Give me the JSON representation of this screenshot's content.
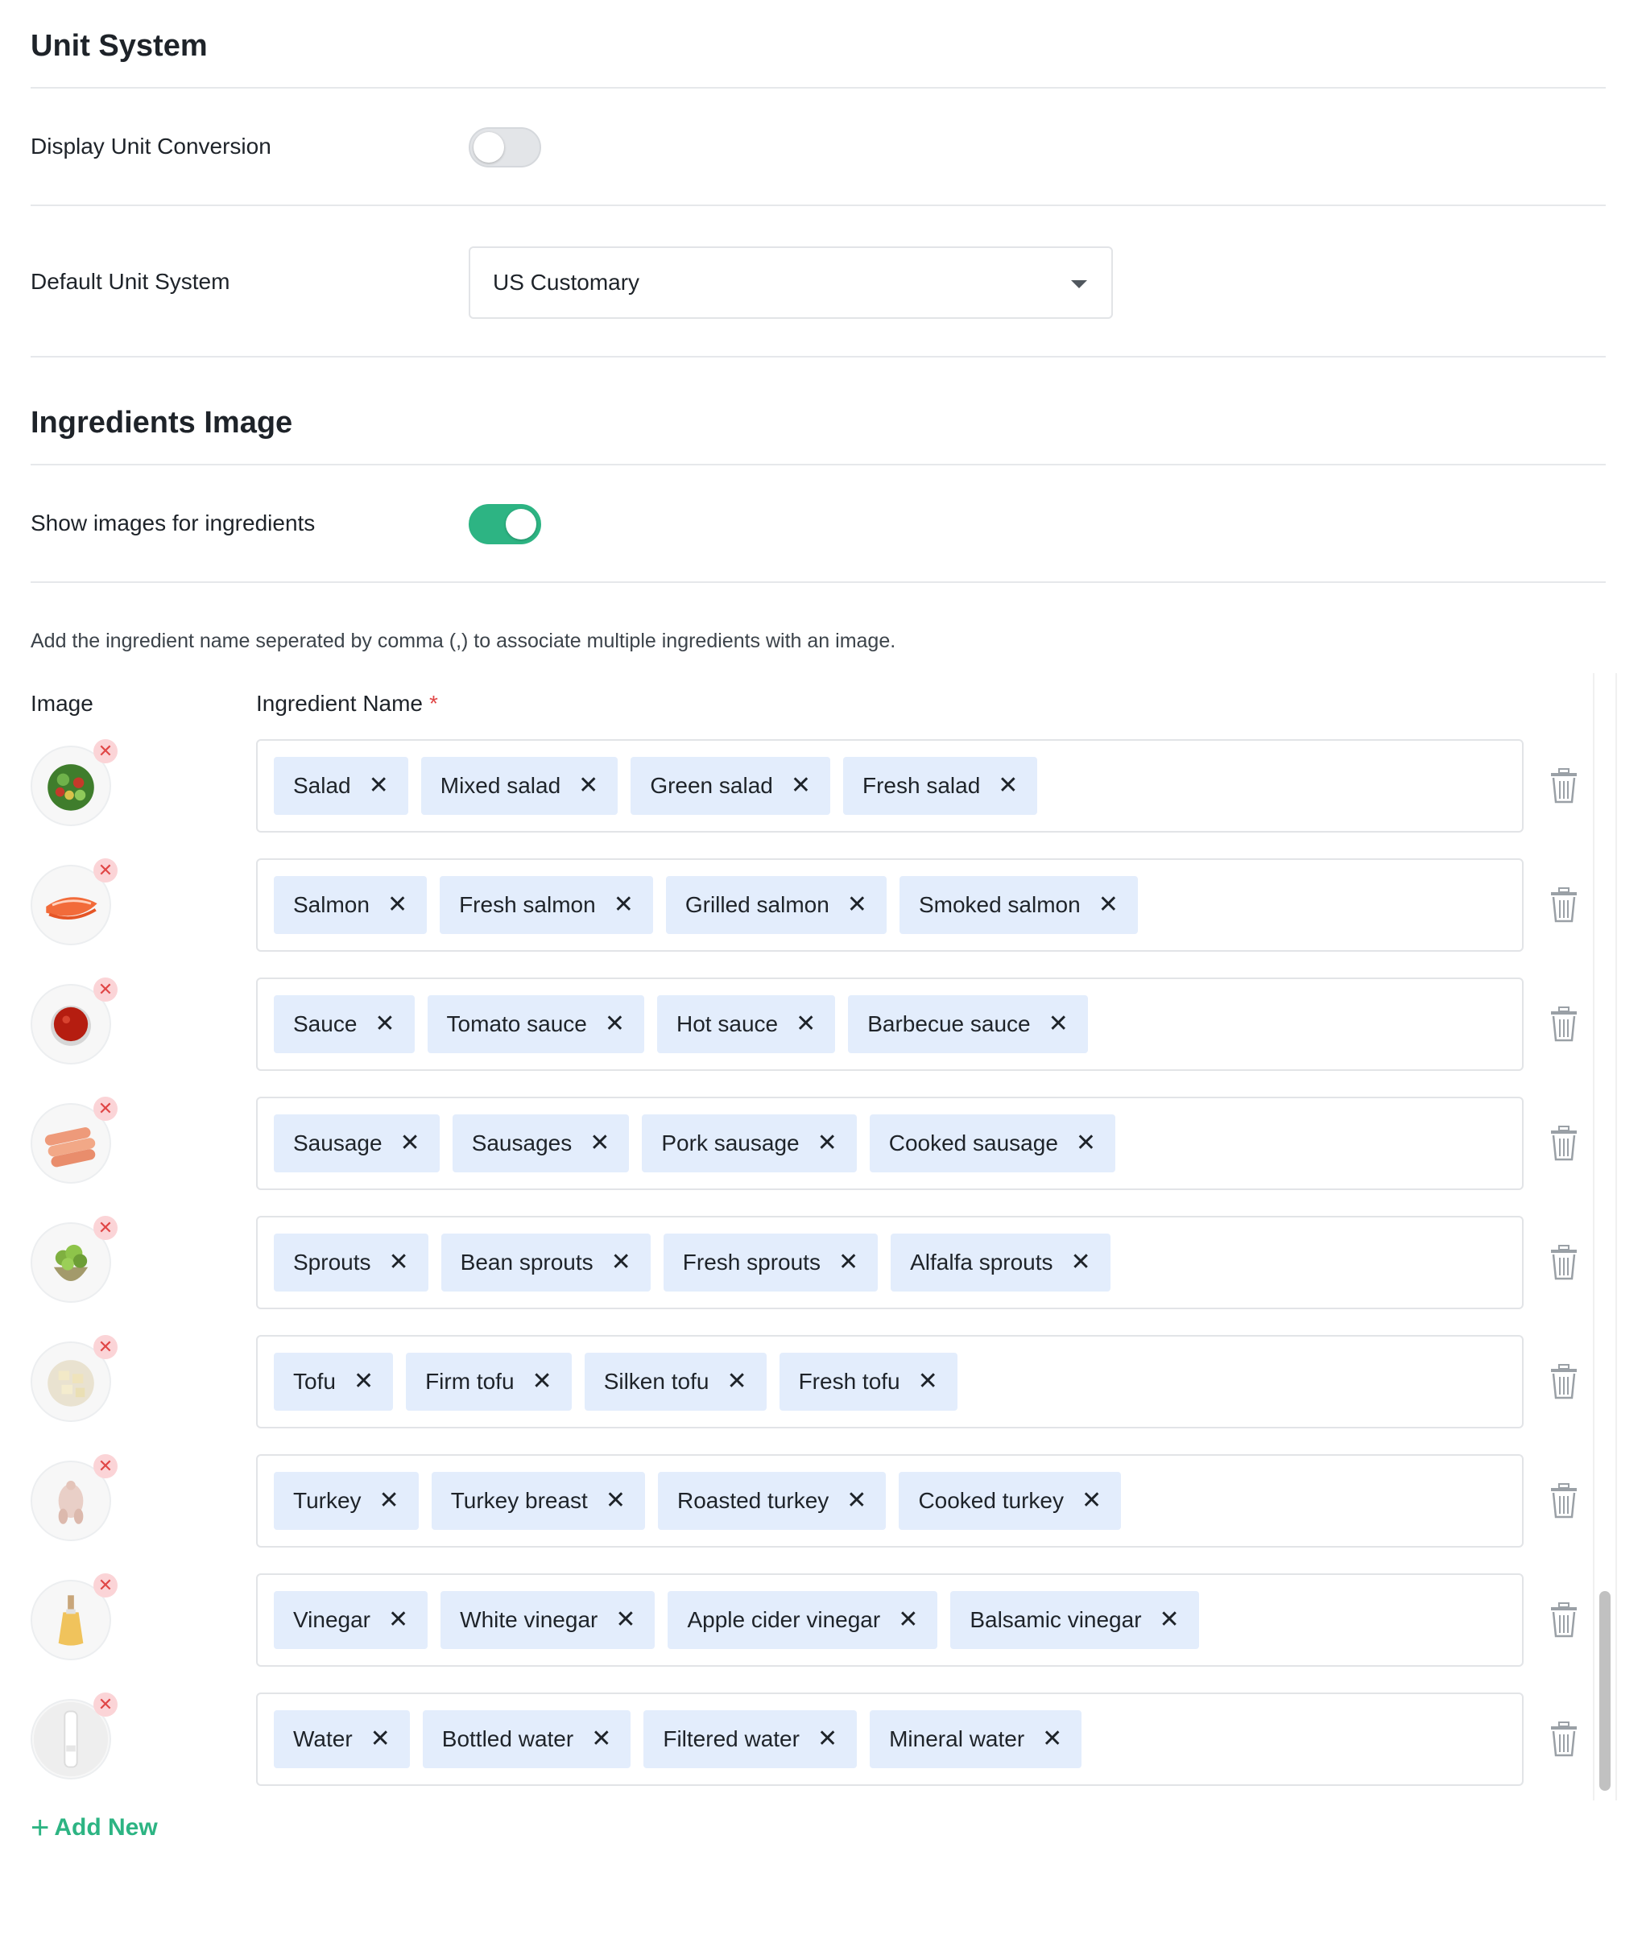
{
  "unit_system": {
    "title": "Unit System",
    "display_conversion_label": "Display Unit Conversion",
    "display_conversion_on": false,
    "default_unit_label": "Default Unit System",
    "default_unit_value": "US Customary"
  },
  "ingredients_image": {
    "title": "Ingredients Image",
    "show_images_label": "Show images for ingredients",
    "show_images_on": true,
    "hint": "Add the ingredient name seperated by comma (,) to associate multiple ingredients with an image.",
    "col_image": "Image",
    "col_name": "Ingredient Name",
    "required_mark": "*",
    "remove_glyph": "✕",
    "tag_remove_glyph": "✕",
    "rows": [
      {
        "image": "salad-icon",
        "tags": [
          "Salad",
          "Mixed salad",
          "Green salad",
          "Fresh salad"
        ]
      },
      {
        "image": "salmon-icon",
        "tags": [
          "Salmon",
          "Fresh salmon",
          "Grilled salmon",
          "Smoked salmon"
        ]
      },
      {
        "image": "sauce-icon",
        "tags": [
          "Sauce",
          "Tomato sauce",
          "Hot sauce",
          "Barbecue sauce"
        ]
      },
      {
        "image": "sausage-icon",
        "tags": [
          "Sausage",
          "Sausages",
          "Pork sausage",
          "Cooked sausage"
        ]
      },
      {
        "image": "sprouts-icon",
        "tags": [
          "Sprouts",
          "Bean sprouts",
          "Fresh sprouts",
          "Alfalfa sprouts"
        ]
      },
      {
        "image": "tofu-icon",
        "tags": [
          "Tofu",
          "Firm tofu",
          "Silken tofu",
          "Fresh tofu"
        ]
      },
      {
        "image": "turkey-icon",
        "tags": [
          "Turkey",
          "Turkey breast",
          "Roasted turkey",
          "Cooked turkey"
        ]
      },
      {
        "image": "vinegar-icon",
        "tags": [
          "Vinegar",
          "White vinegar",
          "Apple cider vinegar",
          "Balsamic vinegar"
        ]
      },
      {
        "image": "water-icon",
        "tags": [
          "Water",
          "Bottled water",
          "Filtered water",
          "Mineral water"
        ]
      }
    ],
    "add_new_label": "Add New"
  },
  "colors": {
    "accent": "#2db483",
    "tag_bg": "#e3edfc",
    "remove_bg": "#fbd4d7",
    "remove_fg": "#e04646"
  }
}
